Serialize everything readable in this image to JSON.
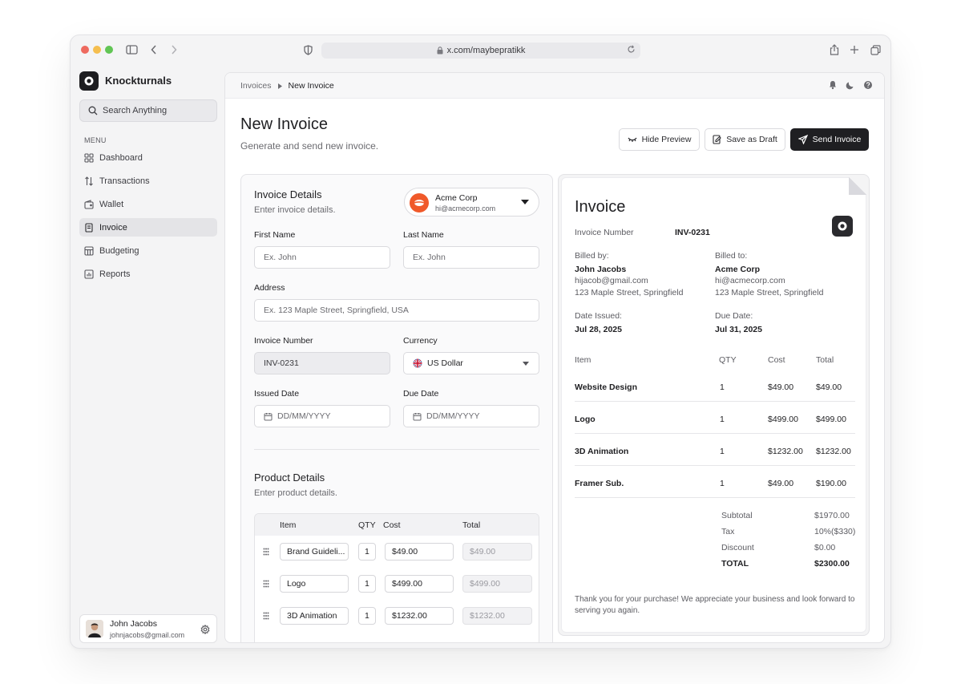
{
  "browser": {
    "url": "x.com/maybepratikk"
  },
  "sidebar": {
    "brand": "Knockturnals",
    "search_placeholder": "Search Anything",
    "menu_label": "MENU",
    "items": [
      {
        "label": "Dashboard",
        "icon": "grid-icon",
        "active": false
      },
      {
        "label": "Transactions",
        "icon": "arrows-updown-icon",
        "active": false
      },
      {
        "label": "Wallet",
        "icon": "wallet-icon",
        "active": false
      },
      {
        "label": "Invoice",
        "icon": "receipt-icon",
        "active": true
      },
      {
        "label": "Budgeting",
        "icon": "calculator-icon",
        "active": false
      },
      {
        "label": "Reports",
        "icon": "chart-icon",
        "active": false
      }
    ],
    "user": {
      "name": "John Jacobs",
      "email": "johnjacobs@gmail.com"
    }
  },
  "header": {
    "breadcrumb": [
      "Invoices",
      "New Invoice"
    ],
    "title": "New Invoice",
    "subtitle": "Generate and send new invoice.",
    "buttons": {
      "hide_preview": "Hide Preview",
      "save_draft": "Save as Draft",
      "send": "Send Invoice"
    }
  },
  "form": {
    "title": "Invoice Details",
    "subtitle": "Enter invoice details.",
    "client": {
      "name": "Acme Corp",
      "email": "hi@acmecorp.com",
      "color": "#f0592a"
    },
    "fields": {
      "first_name": {
        "label": "First Name",
        "placeholder": "Ex. John"
      },
      "last_name": {
        "label": "Last Name",
        "placeholder": "Ex. John"
      },
      "address": {
        "label": "Address",
        "placeholder": "Ex. 123 Maple Street, Springfield, USA"
      },
      "invoice_number": {
        "label": "Invoice Number",
        "value": "INV-0231"
      },
      "currency": {
        "label": "Currency",
        "value": "US Dollar"
      },
      "issued_date": {
        "label": "Issued Date",
        "placeholder": "DD/MM/YYYY"
      },
      "due_date": {
        "label": "Due Date",
        "placeholder": "DD/MM/YYYY"
      }
    },
    "products": {
      "title": "Product Details",
      "subtitle": "Enter product details.",
      "headers": {
        "item": "Item",
        "qty": "QTY",
        "cost": "Cost",
        "total": "Total"
      },
      "rows": [
        {
          "item": "Brand Guideli...",
          "qty": "1",
          "cost": "$49.00",
          "total": "$49.00"
        },
        {
          "item": "Logo",
          "qty": "1",
          "cost": "$499.00",
          "total": "$499.00"
        },
        {
          "item": "3D Animation",
          "qty": "1",
          "cost": "$1232.00",
          "total": "$1232.00"
        }
      ]
    }
  },
  "preview": {
    "title": "Invoice",
    "number_label": "Invoice Number",
    "number": "INV-0231",
    "billed_by_label": "Billed by:",
    "billed_by": {
      "name": "John Jacobs",
      "email": "hijacob@gmail.com",
      "address": "123 Maple Street, Springfield"
    },
    "billed_to_label": "Billed to:",
    "billed_to": {
      "name": "Acme Corp",
      "email": "hi@acmecorp.com",
      "address": "123 Maple Street, Springfield"
    },
    "issued_label": "Date Issued:",
    "issued": "Jul 28, 2025",
    "due_label": "Due Date:",
    "due": "Jul 31, 2025",
    "headers": {
      "item": "Item",
      "qty": "QTY",
      "cost": "Cost",
      "total": "Total"
    },
    "rows": [
      {
        "item": "Website Design",
        "qty": "1",
        "cost": "$49.00",
        "total": "$49.00"
      },
      {
        "item": "Logo",
        "qty": "1",
        "cost": "$499.00",
        "total": "$499.00"
      },
      {
        "item": "3D Animation",
        "qty": "1",
        "cost": "$1232.00",
        "total": "$1232.00"
      },
      {
        "item": "Framer Sub.",
        "qty": "1",
        "cost": "$49.00",
        "total": "$190.00"
      }
    ],
    "summary": {
      "subtotal_label": "Subtotal",
      "subtotal": "$1970.00",
      "tax_label": "Tax",
      "tax": "10%($330)",
      "discount_label": "Discount",
      "discount": "$0.00",
      "total_label": "TOTAL",
      "total": "$2300.00"
    },
    "thanks": "Thank you for your purchase! We appreciate your business and look forward to serving you again."
  }
}
